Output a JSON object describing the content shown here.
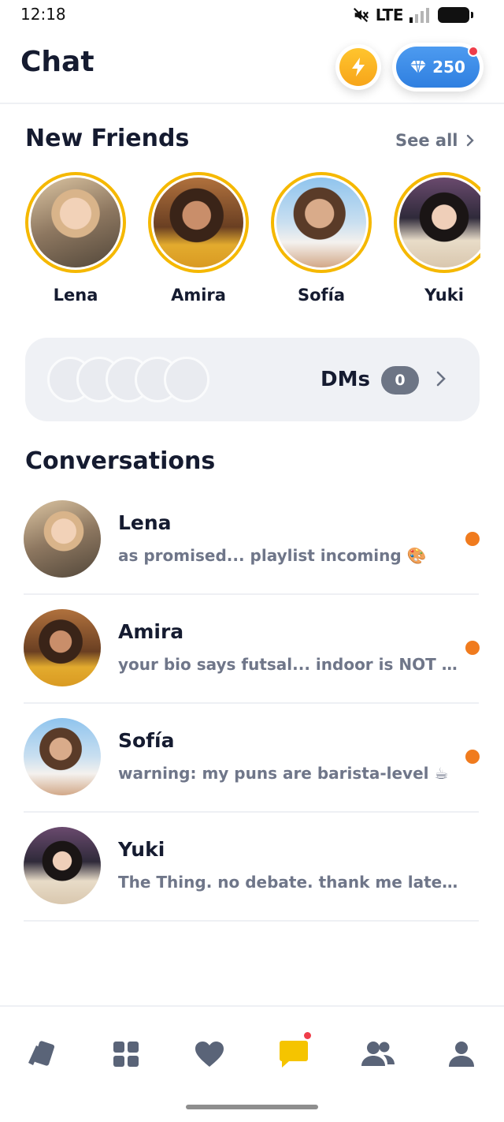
{
  "status_bar": {
    "time": "12:18",
    "network": "LTE"
  },
  "header": {
    "title": "Chat",
    "gems_count": "250",
    "colors": {
      "boost": "#f7b41f",
      "gems": "#3a8ae6",
      "notification": "#ef3d4a"
    }
  },
  "new_friends": {
    "title": "New Friends",
    "see_all_label": "See all",
    "friends": [
      {
        "name": "Lena",
        "avatar_icon": "photo-lena"
      },
      {
        "name": "Amira",
        "avatar_icon": "photo-amira"
      },
      {
        "name": "Sofía",
        "avatar_icon": "photo-sofia"
      },
      {
        "name": "Yuki",
        "avatar_icon": "photo-yuki"
      }
    ]
  },
  "dms": {
    "label": "DMs",
    "count": "0"
  },
  "conversations": {
    "title": "Conversations",
    "items": [
      {
        "name": "Lena",
        "preview": "as promised... playlist incoming 🎨",
        "unread": true
      },
      {
        "name": "Amira",
        "preview": "your bio says futsal... indoor is NOT really futsal",
        "unread": true
      },
      {
        "name": "Sofía",
        "preview": "warning: my puns are barista-level ☕",
        "unread": true
      },
      {
        "name": "Yuki",
        "preview": "The Thing. no debate. thank me later 🎃",
        "unread": false
      }
    ]
  },
  "bottom_nav": {
    "items": [
      {
        "icon": "cards-icon",
        "active": false
      },
      {
        "icon": "grid-icon",
        "active": false
      },
      {
        "icon": "heart-icon",
        "active": false
      },
      {
        "icon": "chat-icon",
        "active": true,
        "badge": true
      },
      {
        "icon": "people-icon",
        "active": false
      },
      {
        "icon": "profile-icon",
        "active": false
      }
    ],
    "colors": {
      "inactive": "#5a6478",
      "active": "#f5c400"
    }
  }
}
